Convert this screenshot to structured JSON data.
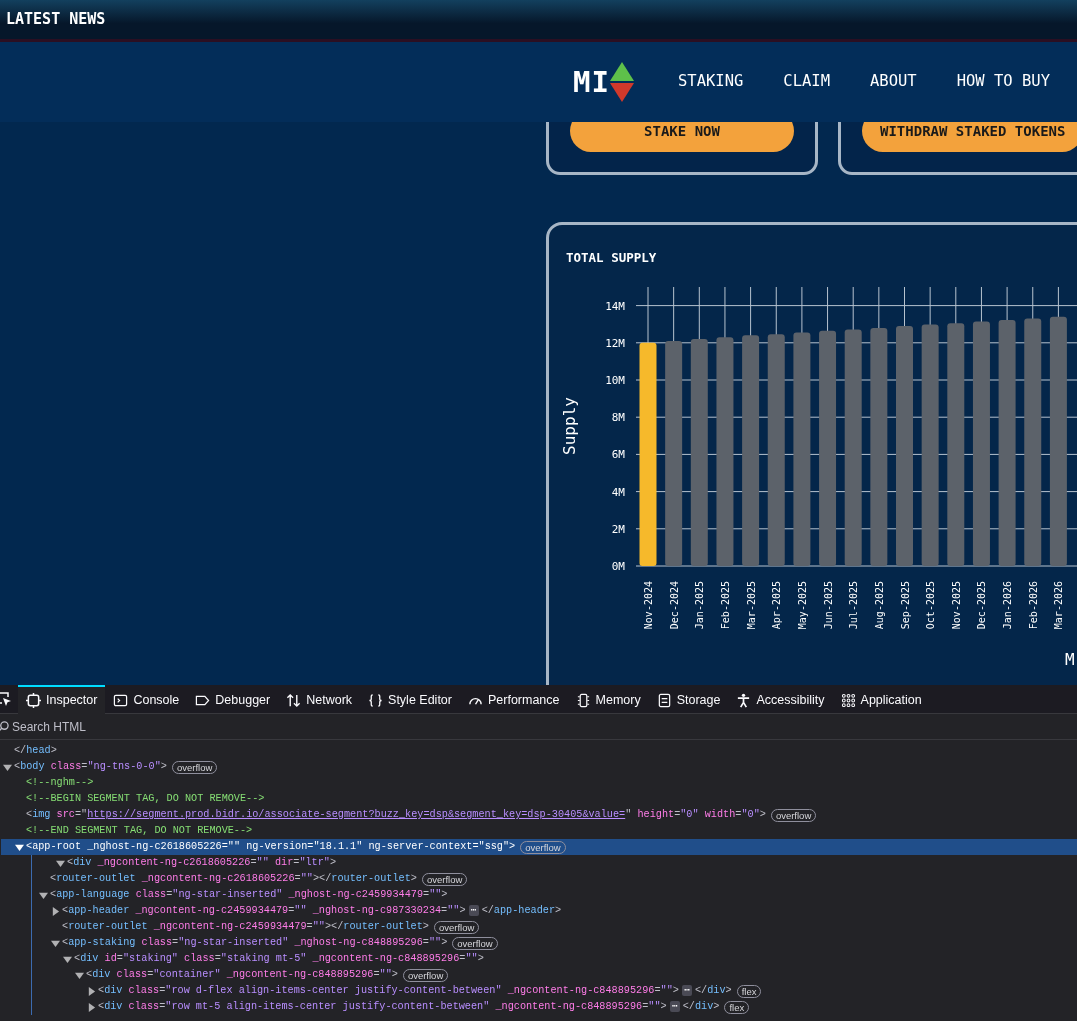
{
  "site": {
    "news_bar": {
      "title": "LATEST NEWS"
    },
    "nav": {
      "logo": "MI",
      "items": [
        {
          "label": "STAKING"
        },
        {
          "label": "CLAIM"
        },
        {
          "label": "ABOUT"
        },
        {
          "label": "HOW TO BUY"
        }
      ]
    },
    "action_cards": [
      {
        "button": "STAKE NOW"
      },
      {
        "button": "WITHDRAW STAKED TOKENS"
      }
    ],
    "supply_card": {
      "title": "TOTAL SUPPLY",
      "chart_data": {
        "type": "bar",
        "ylabel": "Supply",
        "xlabel": "M",
        "categories": [
          "Nov-2024",
          "Dec-2024",
          "Jan-2025",
          "Feb-2025",
          "Mar-2025",
          "Apr-2025",
          "May-2025",
          "Jun-2025",
          "Jul-2025",
          "Aug-2025",
          "Sep-2025",
          "Oct-2025",
          "Nov-2025",
          "Dec-2025",
          "Jan-2026",
          "Feb-2026",
          "Mar-2026"
        ],
        "series": [
          {
            "color": "#f6b92b",
            "values": [
              12,
              null,
              null,
              null,
              null,
              null,
              null,
              null,
              null,
              null,
              null,
              null,
              null,
              null,
              null,
              null,
              null
            ]
          },
          {
            "color": "#5c626a",
            "values": [
              null,
              12.1,
              12.2,
              12.3,
              12.4,
              12.46,
              12.55,
              12.65,
              12.72,
              12.8,
              12.9,
              12.98,
              13.05,
              13.15,
              13.22,
              13.3,
              13.4
            ]
          }
        ],
        "ylim": [
          0,
          15
        ],
        "grid": true,
        "yticks": [
          {
            "value": 0,
            "label": "0M"
          },
          {
            "value": 2,
            "label": "2M"
          },
          {
            "value": 4,
            "label": "4M"
          },
          {
            "value": 6,
            "label": "6M"
          },
          {
            "value": 8,
            "label": "8M"
          },
          {
            "value": 10,
            "label": "10M"
          },
          {
            "value": 12,
            "label": "12M"
          },
          {
            "value": 14,
            "label": "14M"
          }
        ]
      }
    }
  },
  "devtools": {
    "tabs": [
      {
        "label": "Inspector",
        "selected": true
      },
      {
        "label": "Console",
        "selected": false
      },
      {
        "label": "Debugger",
        "selected": false
      },
      {
        "label": "Network",
        "selected": false
      },
      {
        "label": "Style Editor",
        "selected": false
      },
      {
        "label": "Performance",
        "selected": false
      },
      {
        "label": "Memory",
        "selected": false
      },
      {
        "label": "Storage",
        "selected": false
      },
      {
        "label": "Accessibility",
        "selected": false
      },
      {
        "label": "Application",
        "selected": false
      }
    ],
    "search": {
      "placeholder": "Search HTML"
    },
    "tree": [
      {
        "kind": "element",
        "text": "</head>",
        "selected": false
      },
      {
        "kind": "element",
        "text": "<body class=\"ng-tns-0-0\">",
        "badges": [
          "overflow"
        ],
        "selected": false,
        "expanded": true,
        "children": [
          {
            "kind": "comment",
            "text": "<!--nghm-->",
            "selected": false
          },
          {
            "kind": "comment",
            "text": "<!--BEGIN SEGMENT TAG, DO NOT REMOVE-->",
            "selected": false
          },
          {
            "kind": "element",
            "text": "<img src=\"",
            "link": "https://segment.prod.bidr.io/associate-segment?buzz_key=dsp&segment_key=dsp-30405&value=",
            "text_after": "\" height=\"0\" width=\"0\">",
            "badges": [
              "overflow"
            ],
            "selected": false
          },
          {
            "kind": "comment",
            "text": "<!--END SEGMENT TAG, DO NOT REMOVE-->",
            "selected": false
          },
          {
            "kind": "element",
            "text": "<app-root _nghost-ng-c2618605226=\"\" ng-version=\"18.1.1\" ng-server-context=\"ssg\">",
            "badges": [
              "overflow"
            ],
            "selected": true,
            "expanded": true,
            "children": [
              {
                "kind": "element",
                "text": "<div _ngcontent-ng-c2618605226=\"\" dir=\"ltr\">",
                "selected": false,
                "expanded": true,
                "children": [
                  {
                    "kind": "element",
                    "text": "<router-outlet _ngcontent-ng-c2618605226=\"\"></router-outlet>",
                    "badges": [
                      "overflow"
                    ],
                    "selected": false
                  },
                  {
                    "kind": "element",
                    "text": "<app-language class=\"ng-star-inserted\" _nghost-ng-c2459934479=\"\">",
                    "selected": false,
                    "expanded": true,
                    "children": [
                      {
                        "kind": "element",
                        "text": "<app-header _ngcontent-ng-c2459934479=\"\" _nghost-ng-c987330234=\"\">",
                        "ellipsis": "⋯",
                        "text_after": "</app-header>",
                        "selected": false,
                        "expanded": false
                      },
                      {
                        "kind": "element",
                        "text": "<router-outlet _ngcontent-ng-c2459934479=\"\"></router-outlet>",
                        "badges": [
                          "overflow"
                        ],
                        "selected": false
                      },
                      {
                        "kind": "element",
                        "text": "<app-staking class=\"ng-star-inserted\" _nghost-ng-c848895296=\"\">",
                        "badges": [
                          "overflow"
                        ],
                        "selected": false,
                        "expanded": true,
                        "children": [
                          {
                            "kind": "element",
                            "text": "<div id=\"staking\" class=\"staking mt-5\" _ngcontent-ng-c848895296=\"\">",
                            "selected": false,
                            "expanded": true,
                            "children": [
                              {
                                "kind": "element",
                                "text": "<div class=\"container\" _ngcontent-ng-c848895296=\"\">",
                                "badges": [
                                  "overflow"
                                ],
                                "selected": false,
                                "expanded": true,
                                "children": [
                                  {
                                    "kind": "element",
                                    "text": "<div class=\"row d-flex align-items-center justify-content-between\" _ngcontent-ng-c848895296=\"\">",
                                    "ellipsis": "⋯",
                                    "text_after": "</div>",
                                    "badges": [
                                      "flex"
                                    ],
                                    "selected": false,
                                    "expanded": false
                                  },
                                  {
                                    "kind": "element",
                                    "text": "<div class=\"row mt-5 align-items-center justify-content-between\" _ngcontent-ng-c848895296=\"\">",
                                    "ellipsis": "⋯",
                                    "text_after": "</div>",
                                    "badges": [
                                      "flex"
                                    ],
                                    "selected": false,
                                    "expanded": false
                                  }
                                ]
                              }
                            ]
                          }
                        ]
                      }
                    ]
                  }
                ]
              }
            ]
          }
        ]
      }
    ]
  }
}
